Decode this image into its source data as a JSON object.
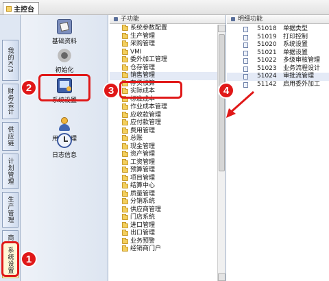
{
  "top_tab": {
    "label": "主控台"
  },
  "left_nav": {
    "items": [
      {
        "label": "我的K/3"
      },
      {
        "label": "财务会计"
      },
      {
        "label": "供应链"
      },
      {
        "label": "计划管理"
      },
      {
        "label": "生产管理"
      },
      {
        "label": "商业智能"
      },
      {
        "label": "系统设置"
      }
    ]
  },
  "functions": [
    {
      "label": "基础资料"
    },
    {
      "label": "初始化"
    },
    {
      "label": "系统设置"
    },
    {
      "label": "用户管理"
    },
    {
      "label": "日志信息"
    }
  ],
  "subfunction_panel": {
    "header": "子功能",
    "items": [
      "系统参数配置",
      "生产管理",
      "采购管理",
      "VMI",
      "委外加工管理",
      "仓存管理",
      "销售管理",
      "存货核算",
      "实际成本",
      "标准成本",
      "作业成本管理",
      "应收款管理",
      "应付款管理",
      "费用管理",
      "总账",
      "现金管理",
      "资产管理",
      "工资管理",
      "预算管理",
      "项目管理",
      "结算中心",
      "质量管理",
      "分销系统",
      "供应商管理",
      "门店系统",
      "进口管理",
      "出口管理",
      "业务预警",
      "经销商门户"
    ]
  },
  "detail_panel": {
    "header": "明细功能",
    "rows": [
      {
        "code": "51018",
        "name": "单据类型"
      },
      {
        "code": "51019",
        "name": "打印控制"
      },
      {
        "code": "51020",
        "name": "系统设置"
      },
      {
        "code": "51021",
        "name": "单据设置"
      },
      {
        "code": "51022",
        "name": "多级审核管理"
      },
      {
        "code": "51023",
        "name": "业务流程设计"
      },
      {
        "code": "51024",
        "name": "审批流管理"
      },
      {
        "code": "51142",
        "name": "启用委外加工"
      }
    ]
  },
  "annotations": {
    "step1": "1",
    "step2": "2",
    "step3": "3",
    "step4": "4"
  },
  "colors": {
    "annotation_red": "#e01818",
    "folder_yellow": "#f3cf5e",
    "nav_blue": "#dfe7f3"
  }
}
